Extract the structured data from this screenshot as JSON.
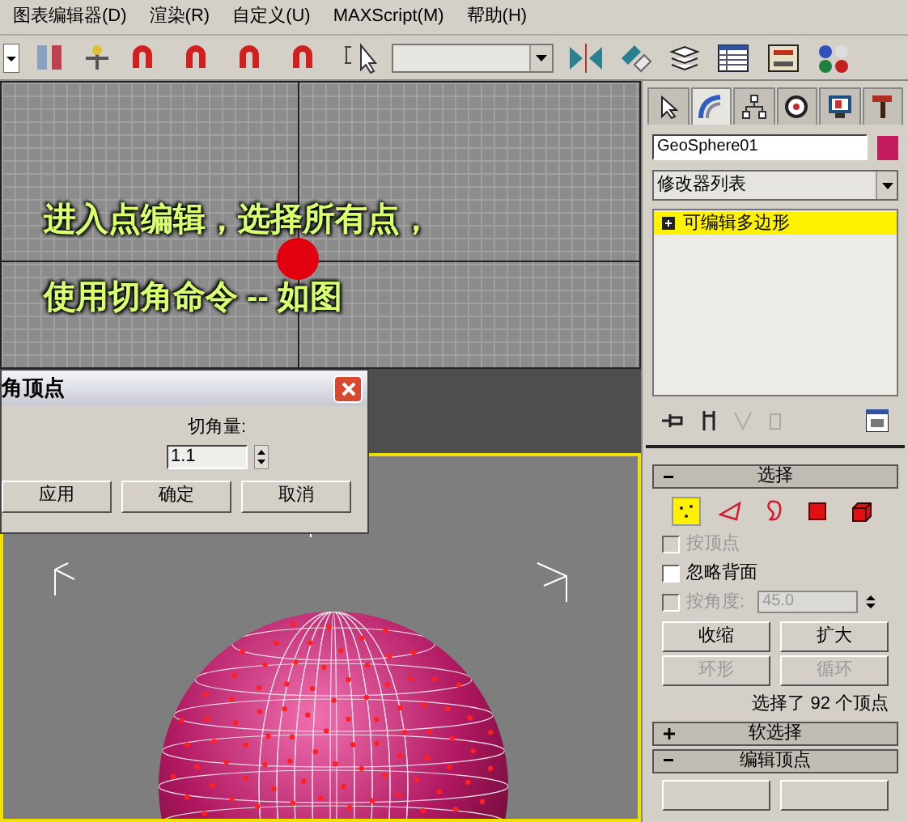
{
  "menu": [
    {
      "label": "图表编辑器(D)"
    },
    {
      "label": "渲染(R)"
    },
    {
      "label": "自定义(U)"
    },
    {
      "label": "MAXScript(M)"
    },
    {
      "label": "帮助(H)"
    }
  ],
  "viewport_overlay": {
    "lines": [
      "进入点编辑，选择所有点，",
      "使用切角命令 -- 如图"
    ]
  },
  "dialog": {
    "title": "角顶点",
    "label": "切角量:",
    "value": "1.1",
    "buttons": [
      "应用",
      "确定",
      "取消"
    ]
  },
  "command_panel": {
    "tabs": [
      {
        "kind": "create",
        "selected": false
      },
      {
        "kind": "modify",
        "selected": true
      },
      {
        "kind": "hierarchy",
        "selected": false
      },
      {
        "kind": "motion",
        "selected": false
      },
      {
        "kind": "display",
        "selected": false
      },
      {
        "kind": "utilities",
        "selected": false
      }
    ],
    "object_name": "GeoSphere01",
    "modifier_list": "修改器列表",
    "stack": [
      {
        "label": "可编辑多边形",
        "selected": true
      }
    ],
    "rollouts": [
      {
        "title": "选择",
        "expanded": true
      },
      {
        "title": "软选择",
        "expanded": false
      },
      {
        "title": "编辑顶点",
        "expanded": true
      }
    ],
    "subobject_levels": [
      {
        "kind": "vertex",
        "selected": true
      },
      {
        "kind": "edge",
        "selected": false
      },
      {
        "kind": "border",
        "selected": false
      },
      {
        "kind": "polygon",
        "selected": false
      },
      {
        "kind": "element",
        "selected": false
      }
    ],
    "checkboxes": [
      {
        "label": "按顶点",
        "checked": false,
        "disabled": true
      },
      {
        "label": "忽略背面",
        "checked": false,
        "disabled": false
      },
      {
        "label": "按角度:",
        "checked": false,
        "disabled": true
      }
    ],
    "angle_value": "45.0",
    "buttons": [
      {
        "label": "收缩",
        "disabled": false
      },
      {
        "label": "扩大",
        "disabled": false
      },
      {
        "label": "环形",
        "disabled": true
      },
      {
        "label": "循环",
        "disabled": true
      }
    ],
    "selection_status": "选择了 92 个顶点"
  }
}
